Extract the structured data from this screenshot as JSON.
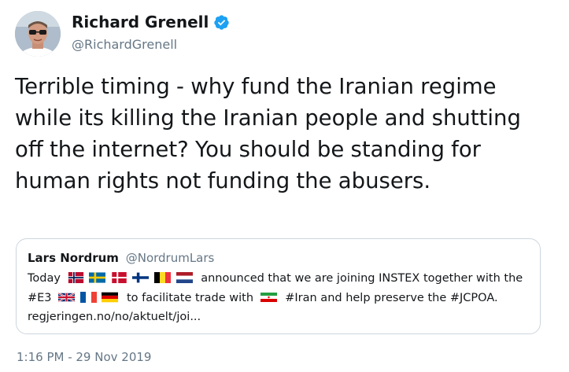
{
  "tweet": {
    "author": {
      "display_name": "Richard Grenell",
      "handle": "@RichardGrenell",
      "verified": true,
      "verified_icon": "verified-badge-icon",
      "avatar": "profile-photo"
    },
    "text": "Terrible timing - why fund the Iranian regime while its killing the Iranian people and shutting off the internet? You should be standing for human rights not funding the abusers.",
    "timestamp": "1:16 PM - 29 Nov 2019"
  },
  "quoted_tweet": {
    "display_name": "Lars Nordrum",
    "handle": "@NordrumLars",
    "line1_prefix": "Today",
    "line1_flags": [
      "norway-flag-icon",
      "sweden-flag-icon",
      "denmark-flag-icon",
      "finland-flag-icon",
      "belgium-flag-icon",
      "netherlands-flag-icon"
    ],
    "line1_suffix": "announced that we are joining INSTEX together with the",
    "line2_prefix": "#E3",
    "line2_flags": [
      "uk-flag-icon",
      "france-flag-icon",
      "germany-flag-icon"
    ],
    "line2_middle": "to facilitate trade with",
    "line2_flags2": [
      "iran-flag-icon"
    ],
    "line2_suffix": "#Iran and help preserve the #JCPOA.",
    "link": "regjeringen.no/no/aktuelt/joi..."
  },
  "colors": {
    "text": "#14171a",
    "secondary": "#657786",
    "border": "#ccd6dd",
    "verified": "#1da1f2"
  }
}
